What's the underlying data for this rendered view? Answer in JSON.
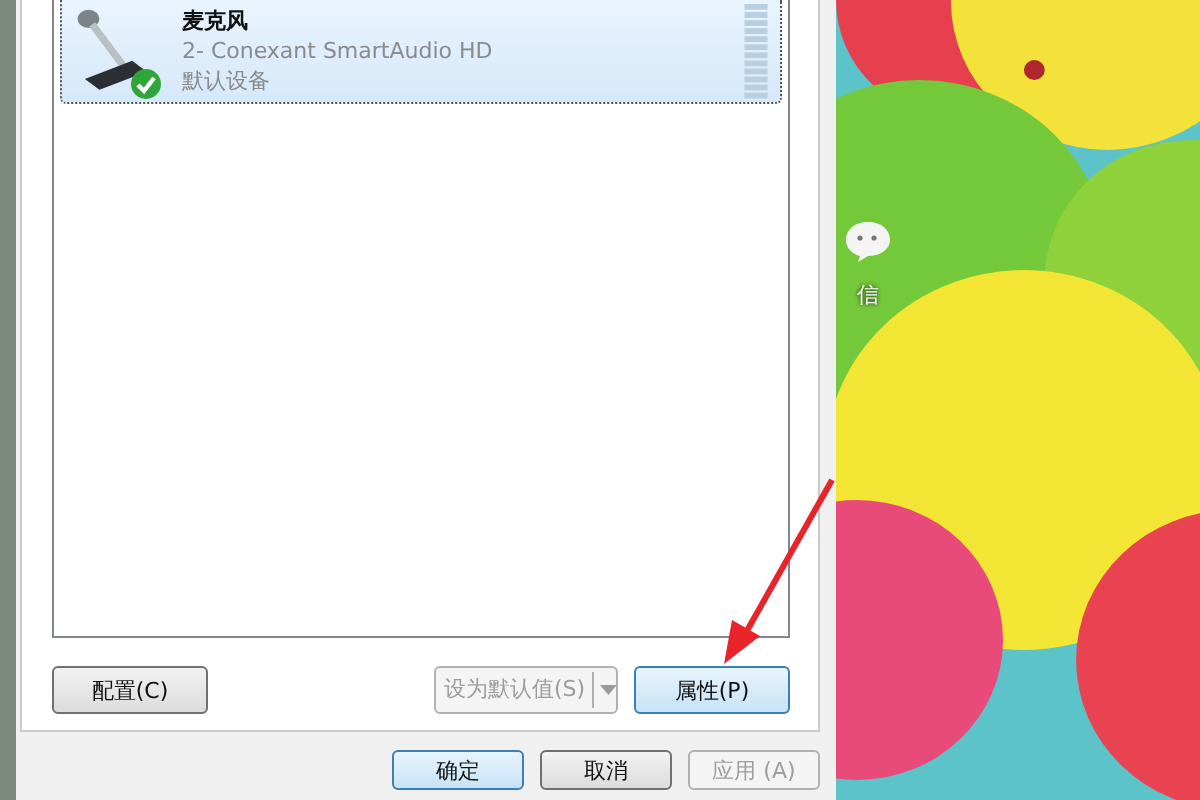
{
  "devices": [
    {
      "name": "麦克风",
      "description": "2- Conexant SmartAudio HD",
      "status": "默认设备",
      "selected": true,
      "default": true
    }
  ],
  "panel_buttons": [
    {
      "label": "配置(C)",
      "kind": "button",
      "disabled": false,
      "focused": false
    },
    {
      "label": "设为默认值(S)",
      "kind": "split",
      "disabled": true,
      "focused": false
    },
    {
      "label": "属性(P)",
      "kind": "button",
      "disabled": false,
      "focused": true
    }
  ],
  "dialog_buttons": [
    {
      "label": "确定",
      "disabled": false,
      "default": true
    },
    {
      "label": "取消",
      "disabled": false,
      "default": false
    },
    {
      "label": "应用 (A)",
      "disabled": true,
      "default": false
    }
  ],
  "desktop_icons": [
    {
      "label": "信"
    }
  ]
}
